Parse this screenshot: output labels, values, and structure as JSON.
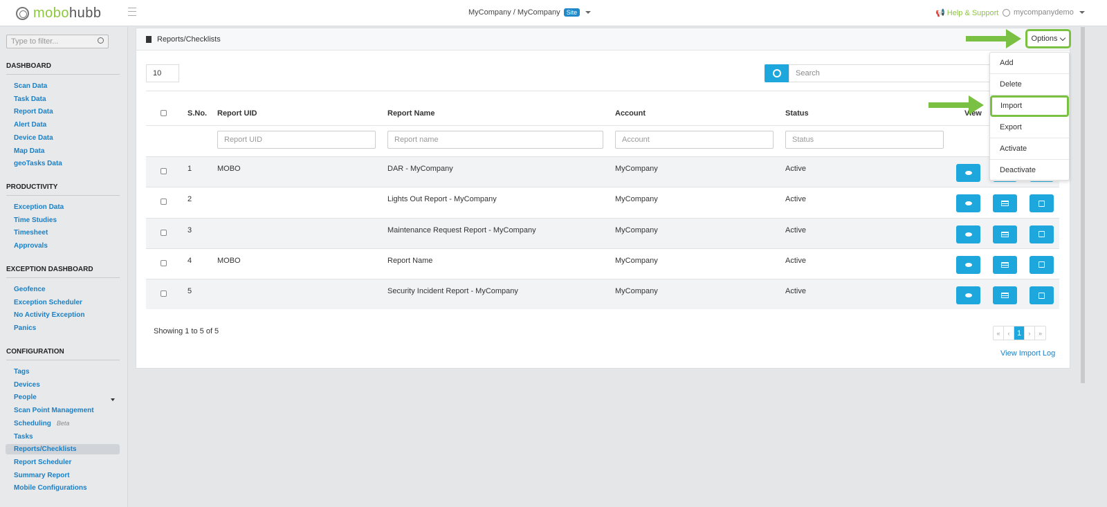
{
  "header": {
    "logo_a": "mobo",
    "logo_b": "hubb",
    "site_path": "MyCompany / MyCompany",
    "site_badge": "Site",
    "help": "Help & Support",
    "user": "mycompanydemo"
  },
  "sidebar": {
    "filter_placeholder": "Type to filter...",
    "sections": [
      {
        "title": "DASHBOARD",
        "items": [
          "Scan Data",
          "Task Data",
          "Report Data",
          "Alert Data",
          "Device Data",
          "Map Data",
          "geoTasks Data"
        ]
      },
      {
        "title": "PRODUCTIVITY",
        "items": [
          "Exception Data",
          "Time Studies",
          "Timesheet",
          "Approvals"
        ]
      },
      {
        "title": "EXCEPTION DASHBOARD",
        "items": [
          "Geofence",
          "Exception Scheduler",
          "No Activity Exception",
          "Panics"
        ]
      },
      {
        "title": "CONFIGURATION",
        "items": [
          "Tags",
          "Devices",
          "People",
          "Scan Point Management",
          "Scheduling",
          "Tasks",
          "Reports/Checklists",
          "Report Scheduler",
          "Summary Report",
          "Mobile Configurations"
        ]
      }
    ],
    "beta": "Beta",
    "active": "Reports/Checklists"
  },
  "panel": {
    "title": "Reports/Checklists",
    "options": "Options",
    "page_length": "10",
    "search_placeholder": "Search",
    "columns": [
      "S.No.",
      "Report UID",
      "Report Name",
      "Account",
      "Status",
      "View"
    ],
    "filters": [
      "Report UID",
      "Report name",
      "Account",
      "Status"
    ],
    "rows": [
      {
        "sno": "1",
        "uid": "MOBO",
        "name": "DAR - MyCompany",
        "account": "MyCompany",
        "status": "Active"
      },
      {
        "sno": "2",
        "uid": "",
        "name": "Lights Out Report - MyCompany",
        "account": "MyCompany",
        "status": "Active"
      },
      {
        "sno": "3",
        "uid": "",
        "name": "Maintenance Request Report - MyCompany",
        "account": "MyCompany",
        "status": "Active"
      },
      {
        "sno": "4",
        "uid": "MOBO",
        "name": "Report Name",
        "account": "MyCompany",
        "status": "Active"
      },
      {
        "sno": "5",
        "uid": "",
        "name": "Security Incident Report - MyCompany",
        "account": "MyCompany",
        "status": "Active"
      }
    ],
    "showing": "Showing 1 to 5 of 5",
    "pagination": [
      "«",
      "‹",
      "1",
      "›",
      "»"
    ],
    "import_log": "View Import Log"
  },
  "options_menu": [
    "Add",
    "Delete",
    "Import",
    "Export",
    "Activate",
    "Deactivate"
  ],
  "highlighted_option": "Import",
  "colors": {
    "accent": "#1ea7dd",
    "link": "#1b7fc4",
    "highlight": "#7ac143",
    "brand_green": "#8dc63f"
  }
}
